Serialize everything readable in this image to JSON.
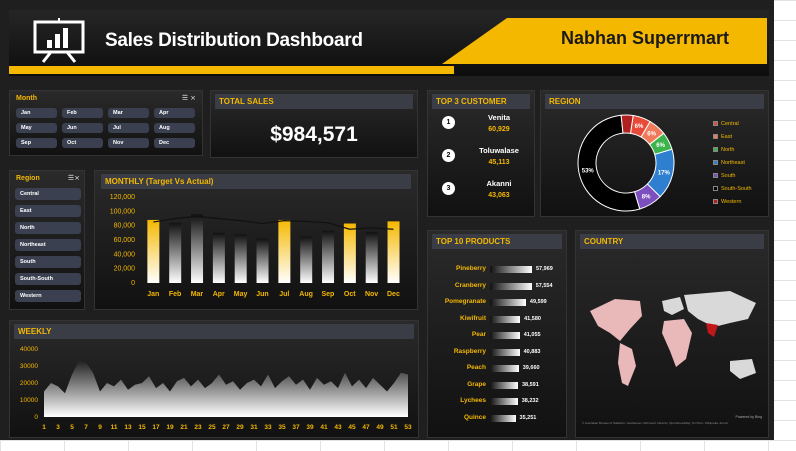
{
  "header": {
    "title": "Sales Distribution Dashboard",
    "brand_plain": "Nabhan ",
    "brand_bold": "Superrmart"
  },
  "month_slicer": {
    "title": "Month",
    "items": [
      "Jan",
      "Feb",
      "Mar",
      "Apr",
      "May",
      "Jun",
      "Jul",
      "Aug",
      "Sep",
      "Oct",
      "Nov",
      "Dec"
    ]
  },
  "region_slicer": {
    "title": "Region",
    "items": [
      "Central",
      "East",
      "North",
      "Northeast",
      "South",
      "South-South",
      "Western"
    ]
  },
  "total_sales": {
    "title": "TOTAL SALES",
    "value": "$984,571"
  },
  "top_customers": {
    "title": "TOP 3 CUSTOMER",
    "items": [
      {
        "rank": "1",
        "name": "Venita",
        "value": "60,929"
      },
      {
        "rank": "2",
        "name": "Toluwalase",
        "value": "45,113"
      },
      {
        "rank": "3",
        "name": "Akanni",
        "value": "43,063"
      }
    ]
  },
  "region_panel": {
    "title": "REGION"
  },
  "monthly_panel": {
    "title": "MONTHLY (Target Vs Actual)"
  },
  "weekly_panel": {
    "title": "WEEKLY"
  },
  "products_panel": {
    "title": "TOP 10 PRODUCTS"
  },
  "country_panel": {
    "title": "COUNTRY",
    "credit_small": "Powered by Bing",
    "credit_footer": "© Australian Bureau of Statistics, GeoNames, Microsoft, Navinfo, OpenStreetMap, TomTom, Wikipedia, Zenrin"
  },
  "colors": {
    "accent": "#f5b800",
    "background": "#1f1f1f"
  },
  "chart_data": [
    {
      "type": "pie",
      "title": "REGION",
      "categories": [
        "Central",
        "East",
        "North",
        "Northeast",
        "South",
        "South-South",
        "Western"
      ],
      "values": [
        6,
        6,
        6,
        17,
        8,
        53,
        4
      ],
      "labels": [
        "6%",
        "6%",
        "6%",
        "17%",
        "8%",
        "53%",
        ""
      ],
      "colors": [
        "#e84a3a",
        "#f07b5c",
        "#3cb44b",
        "#2f7fd1",
        "#7c4fbf",
        "#000000",
        "#b02020"
      ],
      "legend": "right"
    },
    {
      "type": "bar",
      "title": "MONTHLY (Target Vs Actual)",
      "categories": [
        "Jan",
        "Feb",
        "Mar",
        "Apr",
        "May",
        "Jun",
        "Jul",
        "Aug",
        "Sep",
        "Oct",
        "Nov",
        "Dec"
      ],
      "series": [
        {
          "values": [
            88000,
            84000,
            96000,
            70000,
            68000,
            62000,
            88000,
            65000,
            73000,
            83000,
            71000,
            86000
          ]
        },
        {
          "values": [
            85000,
            90000,
            93000,
            90000,
            87000,
            83000,
            87000,
            86000,
            84000,
            75000,
            77000,
            75000
          ]
        }
      ],
      "highlight_months": [
        "Jan",
        "Jul",
        "Oct",
        "Dec"
      ],
      "yticks": [
        "0",
        "20,000",
        "40,000",
        "60,000",
        "80,000",
        "100,000",
        "120,000"
      ],
      "ylim": [
        0,
        120000
      ]
    },
    {
      "type": "area",
      "title": "WEEKLY",
      "x": [
        1,
        2,
        3,
        4,
        5,
        6,
        7,
        8,
        9,
        10,
        11,
        12,
        13,
        14,
        15,
        16,
        17,
        18,
        19,
        20,
        21,
        22,
        23,
        24,
        25,
        26,
        27,
        28,
        29,
        30,
        31,
        32,
        33,
        34,
        35,
        36,
        37,
        38,
        39,
        40,
        41,
        42,
        43,
        44,
        45,
        46,
        47,
        48,
        49,
        50,
        51,
        52,
        53
      ],
      "values": [
        15000,
        20000,
        18000,
        14000,
        25000,
        33000,
        32000,
        26000,
        15000,
        20000,
        18000,
        22000,
        16000,
        19000,
        20000,
        24000,
        17000,
        20000,
        15000,
        21000,
        23000,
        18000,
        22000,
        17000,
        20000,
        25000,
        19000,
        21000,
        16000,
        20000,
        22000,
        18000,
        25000,
        17000,
        21000,
        24000,
        19000,
        22000,
        16000,
        23000,
        19000,
        21000,
        17000,
        26000,
        18000,
        22000,
        17000,
        23000,
        19000,
        15000,
        20000,
        26000,
        25000
      ],
      "xticks": [
        "1",
        "3",
        "5",
        "7",
        "9",
        "11",
        "13",
        "15",
        "17",
        "19",
        "21",
        "23",
        "25",
        "27",
        "29",
        "31",
        "33",
        "35",
        "37",
        "39",
        "41",
        "43",
        "45",
        "47",
        "49",
        "51",
        "53"
      ],
      "yticks": [
        "0",
        "10000",
        "20000",
        "30000",
        "40000"
      ],
      "ylim": [
        0,
        40000
      ]
    },
    {
      "type": "bar",
      "title": "TOP 10 PRODUCTS",
      "categories": [
        "Pineberry",
        "Cranberry",
        "Pomegranate",
        "Kiwifruit",
        "Pear",
        "Raspberry",
        "Peach",
        "Grape",
        "Lychees",
        "Quince"
      ],
      "values": [
        57969,
        57554,
        49599,
        41580,
        41055,
        40883,
        39660,
        38591,
        38232,
        35251
      ],
      "labels": [
        "57,969",
        "57,554",
        "49,599",
        "41,580",
        "41,055",
        "40,883",
        "39,660",
        "38,591",
        "38,232",
        "35,251"
      ]
    }
  ]
}
